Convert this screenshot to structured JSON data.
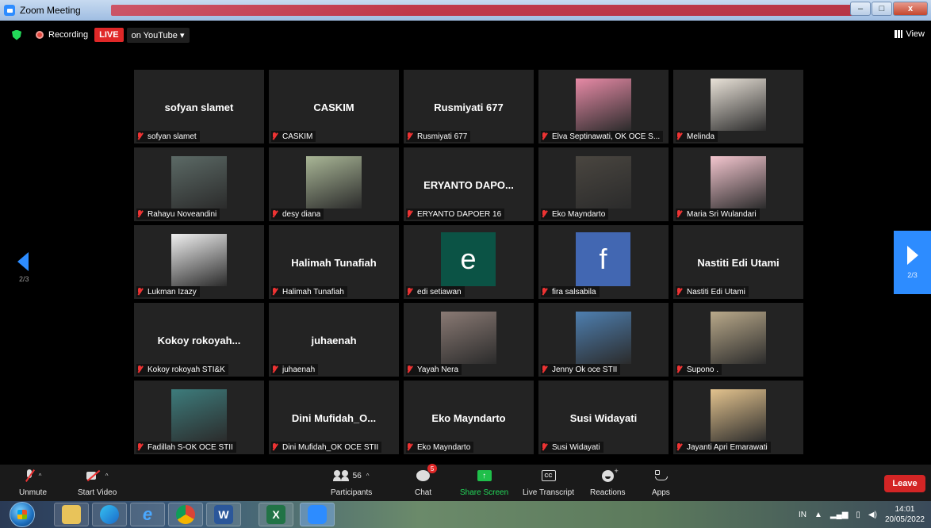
{
  "window": {
    "title": "Zoom Meeting",
    "minimize": "–",
    "maximize": "□",
    "close": "x"
  },
  "topbar": {
    "recording_label": "Recording",
    "live_label": "LIVE",
    "stream_label": "on YouTube ▾",
    "view_label": "View"
  },
  "participants": [
    {
      "display": "sofyan slamet",
      "label": "sofyan slamet",
      "kind": "name"
    },
    {
      "display": "CASKIM",
      "label": "CASKIM",
      "kind": "name"
    },
    {
      "display": "Rusmiyati 677",
      "label": "Rusmiyati 677",
      "kind": "name"
    },
    {
      "display": "",
      "label": "Elva Septinawati, OK OCE S...",
      "kind": "photo",
      "color": "#e78aa6"
    },
    {
      "display": "",
      "label": "Melinda",
      "kind": "photo",
      "color": "#e9e2d8"
    },
    {
      "display": "",
      "label": "Rahayu Noveandini",
      "kind": "photo",
      "color": "#5c6a66"
    },
    {
      "display": "",
      "label": "desy diana",
      "kind": "photo",
      "color": "#a9b696"
    },
    {
      "display": "ERYANTO DAPO...",
      "label": "ERYANTO DAPOER 16",
      "kind": "name"
    },
    {
      "display": "",
      "label": "Eko Mayndarto",
      "kind": "photo",
      "color": "#4a4640"
    },
    {
      "display": "",
      "label": "Maria Sri Wulandari",
      "kind": "photo",
      "color": "#f4c6cf"
    },
    {
      "display": "",
      "label": "Lukman Izazy",
      "kind": "photo",
      "color": "#f0f0f0"
    },
    {
      "display": "Halimah Tunafiah",
      "label": "Halimah Tunafiah",
      "kind": "name"
    },
    {
      "display": "e",
      "label": "edi setiawan",
      "kind": "letter",
      "color": "#0b5345"
    },
    {
      "display": "f",
      "label": "fira salsabila",
      "kind": "letter",
      "color": "#4267b2"
    },
    {
      "display": "Nastiti Edi Utami",
      "label": "Nastiti Edi Utami",
      "kind": "name"
    },
    {
      "display": "Kokoy rokoyah...",
      "label": "Kokoy rokoyah STI&K",
      "kind": "name"
    },
    {
      "display": "juhaenah",
      "label": "juhaenah",
      "kind": "name"
    },
    {
      "display": "",
      "label": "Yayah Nera",
      "kind": "photo",
      "color": "#8a7a74"
    },
    {
      "display": "",
      "label": "Jenny Ok oce STII",
      "kind": "photo",
      "color": "#4e7fb0"
    },
    {
      "display": "",
      "label": "Supono .",
      "kind": "photo",
      "color": "#b9a98a"
    },
    {
      "display": "",
      "label": "Fadillah S-OK OCE STII",
      "kind": "photo",
      "color": "#3d7c7c"
    },
    {
      "display": "Dini Mufidah_O...",
      "label": "Dini Mufidah_OK OCE STII",
      "kind": "name"
    },
    {
      "display": "Eko Mayndarto",
      "label": "Eko Mayndarto",
      "kind": "name"
    },
    {
      "display": "Susi Widayati",
      "label": "Susi Widayati",
      "kind": "name"
    },
    {
      "display": "",
      "label": "Jayanti Apri Emarawati",
      "kind": "photo",
      "color": "#e3c38e"
    }
  ],
  "pagination": {
    "left": "2/3",
    "right": "2/3"
  },
  "toolbar": {
    "unmute": "Unmute",
    "start_video": "Start Video",
    "participants_count": "56",
    "participants": "Participants",
    "chat_badge": "5",
    "chat": "Chat",
    "share": "Share Screen",
    "live_transcript": "Live Transcript",
    "cc": "CC",
    "reactions": "Reactions",
    "apps": "Apps",
    "leave": "Leave"
  },
  "taskbar": {
    "ime": "IN",
    "time": "14:01",
    "date": "20/05/2022"
  }
}
